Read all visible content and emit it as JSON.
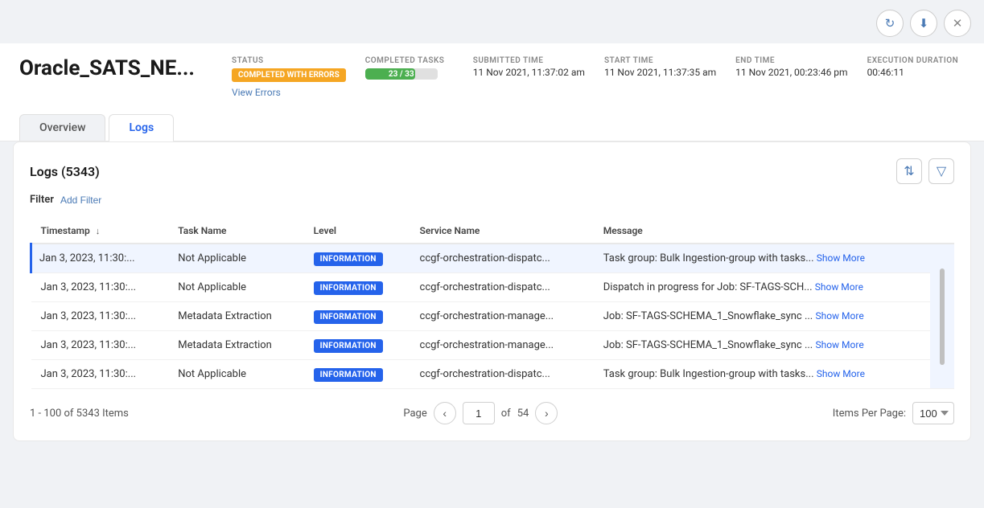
{
  "topbar": {
    "refresh_icon": "↻",
    "download_icon": "⬇",
    "close_icon": "✕"
  },
  "header": {
    "job_title": "Oracle_SATS_NE...",
    "status_label": "STATUS",
    "status_badge": "COMPLETED WITH ERRORS",
    "view_errors_label": "View Errors",
    "completed_tasks_label": "COMPLETED TASKS",
    "completed_tasks_value": "23 / 33",
    "progress_percent": 69.7,
    "submitted_time_label": "SUBMITTED TIME",
    "submitted_time_value": "11 Nov 2021, 11:37:02 am",
    "start_time_label": "START TIME",
    "start_time_value": "11 Nov 2021, 11:37:35 am",
    "end_time_label": "END TIME",
    "end_time_value": "11 Nov 2021, 00:23:46 pm",
    "execution_duration_label": "EXECUTION DURATION",
    "execution_duration_value": "00:46:11"
  },
  "tabs": {
    "overview_label": "Overview",
    "logs_label": "Logs"
  },
  "logs": {
    "title": "Logs (5343)",
    "filter_label": "Filter",
    "add_filter_label": "Add Filter",
    "columns": {
      "timestamp": "Timestamp",
      "task_name": "Task Name",
      "level": "Level",
      "service_name": "Service Name",
      "message": "Message"
    },
    "rows": [
      {
        "timestamp": "Jan 3, 2023, 11:30:...",
        "task_name": "Not Applicable",
        "level": "INFORMATION",
        "service_name": "ccgf-orchestration-dispatc...",
        "message": "Task group: Bulk Ingestion-group with tasks...",
        "show_more": "Show More",
        "highlighted": true
      },
      {
        "timestamp": "Jan 3, 2023, 11:30:...",
        "task_name": "Not Applicable",
        "level": "INFORMATION",
        "service_name": "ccgf-orchestration-dispatc...",
        "message": "Dispatch in progress for Job: SF-TAGS-SCH...",
        "show_more": "Show More",
        "highlighted": false
      },
      {
        "timestamp": "Jan 3, 2023, 11:30:...",
        "task_name": "Metadata Extraction",
        "level": "INFORMATION",
        "service_name": "ccgf-orchestration-manage...",
        "message": "Job: SF-TAGS-SCHEMA_1_Snowflake_sync ...",
        "show_more": "Show More",
        "highlighted": false
      },
      {
        "timestamp": "Jan 3, 2023, 11:30:...",
        "task_name": "Metadata Extraction",
        "level": "INFORMATION",
        "service_name": "ccgf-orchestration-manage...",
        "message": "Job: SF-TAGS-SCHEMA_1_Snowflake_sync ...",
        "show_more": "Show More",
        "highlighted": false
      },
      {
        "timestamp": "Jan 3, 2023, 11:30:...",
        "task_name": "Not Applicable",
        "level": "INFORMATION",
        "service_name": "ccgf-orchestration-dispatc...",
        "message": "Task group: Bulk Ingestion-group with tasks...",
        "show_more": "Show More",
        "highlighted": false
      }
    ],
    "pagination": {
      "items_info": "1 - 100 of 5343 Items",
      "page_label": "Page",
      "current_page": "1",
      "total_pages": "54",
      "of_label": "of",
      "items_per_page_label": "Items Per Page:",
      "items_per_page_value": "100"
    }
  }
}
